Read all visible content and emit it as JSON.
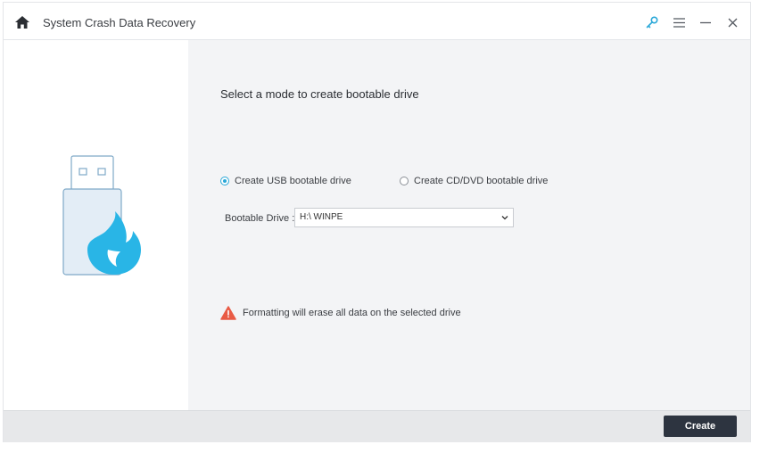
{
  "app": {
    "title": "System Crash Data Recovery",
    "icons": [
      "home-icon",
      "key-icon",
      "menu-icon",
      "minimize-icon",
      "close-icon"
    ]
  },
  "main": {
    "heading": "Select a mode to create bootable drive",
    "options": [
      {
        "label": "Create USB bootable drive",
        "selected": true
      },
      {
        "label": "Create CD/DVD bootable drive",
        "selected": false
      }
    ],
    "drive": {
      "label": "Bootable Drive :",
      "value": "H:\\ WINPE"
    },
    "warning": "Formatting will erase all data on the selected drive"
  },
  "footer": {
    "create_label": "Create"
  },
  "colors": {
    "accent": "#2aa8d8",
    "usb_body": "#e3edf6",
    "usb_outline": "#7fa9c8",
    "flame": "#29b5e6",
    "warning": "#e95b45",
    "button": "#2d3440"
  }
}
